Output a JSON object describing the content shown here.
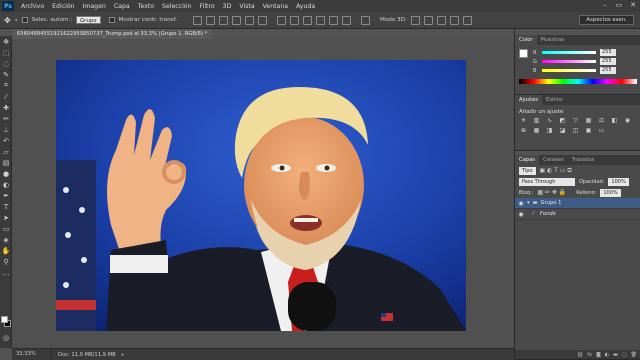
{
  "app": {
    "logo": "Ps"
  },
  "menu": [
    "Archivo",
    "Edición",
    "Imagen",
    "Capa",
    "Texto",
    "Selección",
    "Filtro",
    "3D",
    "Vista",
    "Ventana",
    "Ayuda"
  ],
  "options_bar": {
    "auto_select_label": "Selec. autom.:",
    "auto_select_value": "Grupo",
    "show_transform_label": "Mostrar contr. transf.",
    "mode_3d_label": "Modo 3D:",
    "workspace": "Aspectos esen."
  },
  "document": {
    "tab_title": "6360489455192162295S850737_Trump.psd al 33,3% (Grupo 1, RGB/8) *"
  },
  "status": {
    "zoom": "33,33%",
    "doc_info": "Doc: 11,9 MB/11,9 MB"
  },
  "color_panel": {
    "tabs": [
      "Color",
      "Muestras"
    ],
    "channels": [
      {
        "label": "R",
        "value": "255"
      },
      {
        "label": "G",
        "value": "255"
      },
      {
        "label": "B",
        "value": "255"
      }
    ]
  },
  "adjustments_panel": {
    "tabs": [
      "Ajustes",
      "Estilos"
    ],
    "title": "Añadir un ajuste"
  },
  "layers_panel": {
    "tabs": [
      "Capas",
      "Canales",
      "Trazados"
    ],
    "kind_filter": "Tipo",
    "blend_mode": "Pass Through",
    "opacity_label": "Opacidad:",
    "opacity_value": "100%",
    "lock_label": "Bloq.:",
    "fill_label": "Relleno:",
    "fill_value": "100%",
    "layers": [
      {
        "name": "Grupo 1",
        "selected": true
      },
      {
        "name": "Fondo",
        "selected": false
      }
    ]
  }
}
